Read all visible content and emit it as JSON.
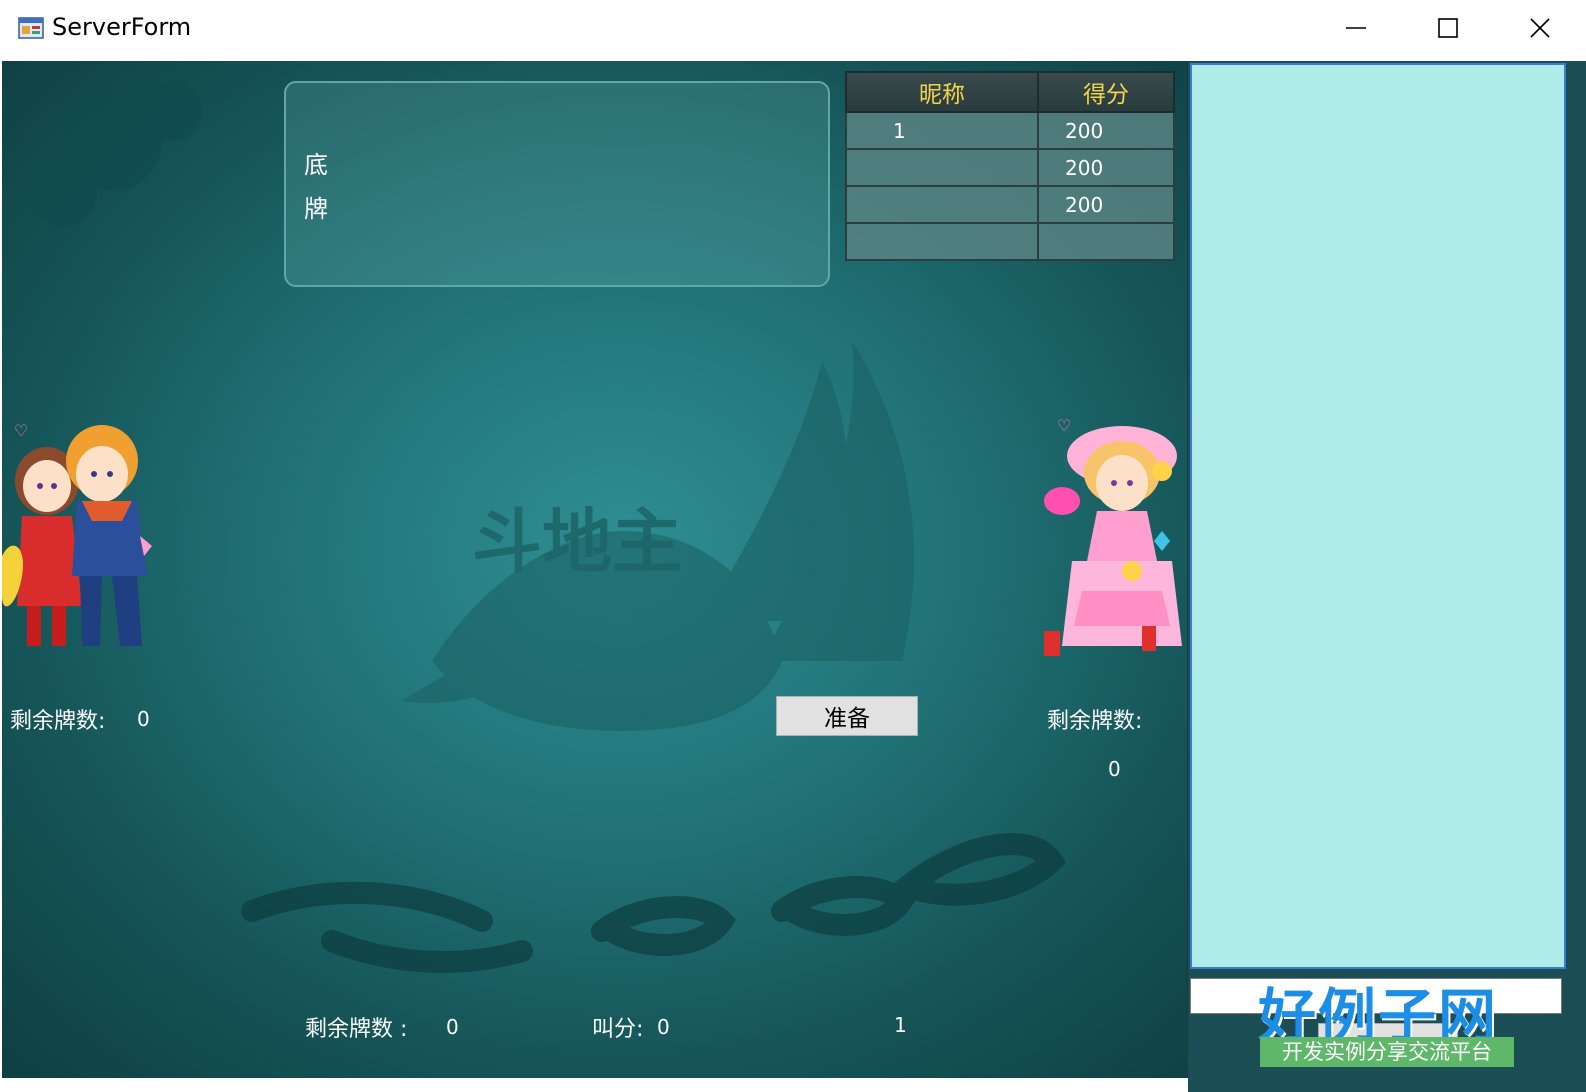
{
  "window": {
    "title": "ServerForm",
    "icons": {
      "app": "app-form-icon",
      "minimize": "minimize-icon",
      "maximize": "maximize-icon",
      "close": "close-icon"
    }
  },
  "game": {
    "bottom_cards_label": "底\n牌",
    "score_table": {
      "headers": [
        "昵称",
        "得分"
      ],
      "rows": [
        [
          "1",
          "200"
        ],
        [
          "",
          "200"
        ],
        [
          "",
          "200"
        ],
        [
          "",
          ""
        ]
      ]
    },
    "left_player": {
      "remain_label": "剩余牌数:",
      "remain_value": "0"
    },
    "right_player": {
      "remain_label": "剩余牌数:",
      "remain_value": "0"
    },
    "bottom_player": {
      "remain_label": "剩余牌数 :",
      "remain_value": "0",
      "call_score_label": "叫分:",
      "call_score_value": "0",
      "player_value": "1"
    },
    "ready_button": "准备",
    "colors": {
      "table_bg": "#217377",
      "header_text": "#f2d44a",
      "chat_bg": "#afedea"
    }
  },
  "logo": {
    "title": "好例子网",
    "subtitle": "开发实例分享交流平台"
  }
}
